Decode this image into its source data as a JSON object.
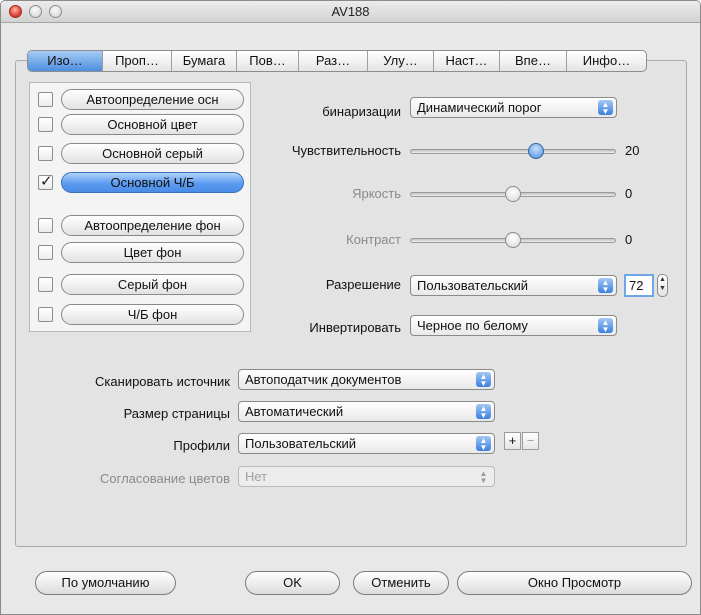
{
  "window": {
    "title": "AV188"
  },
  "tabs": [
    {
      "label": "Изо…",
      "active": true
    },
    {
      "label": "Проп…",
      "active": false
    },
    {
      "label": "Бумага",
      "active": false
    },
    {
      "label": "Пов…",
      "active": false
    },
    {
      "label": "Раз…",
      "active": false
    },
    {
      "label": "Улу…",
      "active": false
    },
    {
      "label": "Наст…",
      "active": false
    },
    {
      "label": "Впе…",
      "active": false
    },
    {
      "label": "Инфо…",
      "active": false
    }
  ],
  "image_types": [
    {
      "label": "Автоопределение осн",
      "checked": false,
      "selected": false
    },
    {
      "label": "Основной цвет",
      "checked": false,
      "selected": false
    },
    {
      "label": "Основной серый",
      "checked": false,
      "selected": false
    },
    {
      "label": "Основной Ч/Б",
      "checked": true,
      "selected": true
    },
    {
      "label": "Автоопределение фон",
      "checked": false,
      "selected": false
    },
    {
      "label": "Цвет фон",
      "checked": false,
      "selected": false
    },
    {
      "label": "Серый фон",
      "checked": false,
      "selected": false
    },
    {
      "label": "Ч/Б фон",
      "checked": false,
      "selected": false
    }
  ],
  "settings": {
    "binarization": {
      "label": "бинаризации",
      "value": "Динамический порог"
    },
    "sensitivity": {
      "label": "Чувствительность",
      "value": "20",
      "level": 0.62,
      "enabled": true
    },
    "brightness": {
      "label": "Яркость",
      "value": "0",
      "level": 0.5,
      "enabled": false
    },
    "contrast": {
      "label": "Контраст",
      "value": "0",
      "level": 0.5,
      "enabled": false
    },
    "resolution": {
      "label": "Разрешение",
      "value": "Пользовательский",
      "number": "72"
    },
    "invert": {
      "label": "Инвертировать",
      "value": "Черное по белому"
    }
  },
  "source": {
    "scan_source": {
      "label": "Сканировать источник",
      "value": "Автоподатчик документов"
    },
    "page_size": {
      "label": "Размер страницы",
      "value": "Автоматический"
    },
    "profiles": {
      "label": "Профили",
      "value": "Пользовательский",
      "add": "+",
      "remove": "−"
    },
    "color_matching": {
      "label": "Согласование цветов",
      "value": "Нет"
    }
  },
  "buttons": {
    "defaults": "По умолчанию",
    "ok": "OK",
    "cancel": "Отменить",
    "preview": "Окно Просмотр"
  },
  "colors": {
    "accent": "#4a8be6",
    "selected_text_bg": "#b3d4fb"
  },
  "icons": {
    "checkmark": "checkmark-icon",
    "popup_arrows": "updown-arrows-icon"
  }
}
